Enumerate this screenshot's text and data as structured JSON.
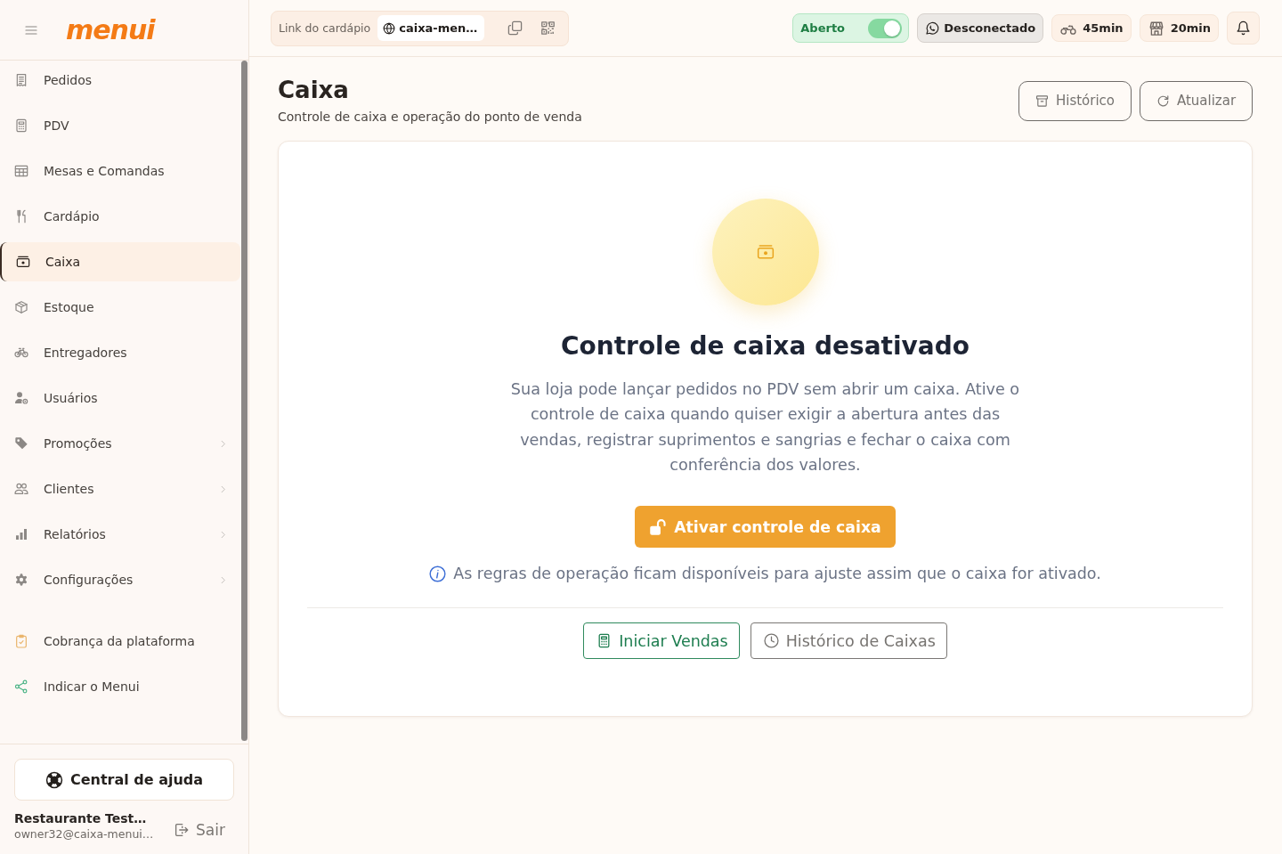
{
  "sidebar": {
    "logo": "menui",
    "nav_items": [
      {
        "label": "Pedidos",
        "selected": false,
        "has_submenu": false
      },
      {
        "label": "PDV",
        "selected": false,
        "has_submenu": false
      },
      {
        "label": "Mesas e Comandas",
        "selected": false,
        "has_submenu": false
      },
      {
        "label": "Cardápio",
        "selected": false,
        "has_submenu": false
      },
      {
        "label": "Caixa",
        "selected": true,
        "has_submenu": false
      },
      {
        "label": "Estoque",
        "selected": false,
        "has_submenu": false
      },
      {
        "label": "Entregadores",
        "selected": false,
        "has_submenu": false
      },
      {
        "label": "Usuários",
        "selected": false,
        "has_submenu": false
      },
      {
        "label": "Promoções",
        "selected": false,
        "has_submenu": true
      },
      {
        "label": "Clientes",
        "selected": false,
        "has_submenu": true
      },
      {
        "label": "Relatórios",
        "selected": false,
        "has_submenu": true
      },
      {
        "label": "Configurações",
        "selected": false,
        "has_submenu": true
      }
    ],
    "extra_items": [
      {
        "label": "Cobrança da plataforma",
        "selected": false
      },
      {
        "label": "Indicar o Menui",
        "selected": false
      }
    ],
    "help_button": "Central de ajuda",
    "user": {
      "name": "Restaurante Test…",
      "email": "owner32@caixa-menui…"
    },
    "logout_button": "Sair"
  },
  "topbar": {
    "menu_link": {
      "label": "Link do cardápio",
      "url": "caixa-men…"
    },
    "store_status": {
      "label": "Aberto",
      "on": true
    },
    "whatsapp_status": {
      "label": "Desconectado",
      "connected": false
    },
    "time_chips": [
      {
        "label": "45min"
      },
      {
        "label": "20min"
      }
    ]
  },
  "page": {
    "title": "Caixa",
    "subtitle": "Controle de caixa e operação do ponto de venda",
    "actions": [
      {
        "label": "Histórico"
      },
      {
        "label": "Atualizar"
      }
    ]
  },
  "empty_state": {
    "title": "Controle de caixa desativado",
    "description": "Sua loja pode lançar pedidos no PDV sem abrir um caixa. Ative o controle de caixa quando quiser exigir a abertura antes das vendas, registrar suprimentos e sangrias e fechar o caixa com conferência dos valores.",
    "primary_button": "Ativar controle de caixa",
    "note": "As regras de operação ficam disponíveis para ajuste assim que o caixa for ativado.",
    "secondary_buttons": [
      {
        "label": "Iniciar Vendas",
        "kind": "positive"
      },
      {
        "label": "Histórico de Caixas",
        "kind": "neutral"
      }
    ]
  }
}
